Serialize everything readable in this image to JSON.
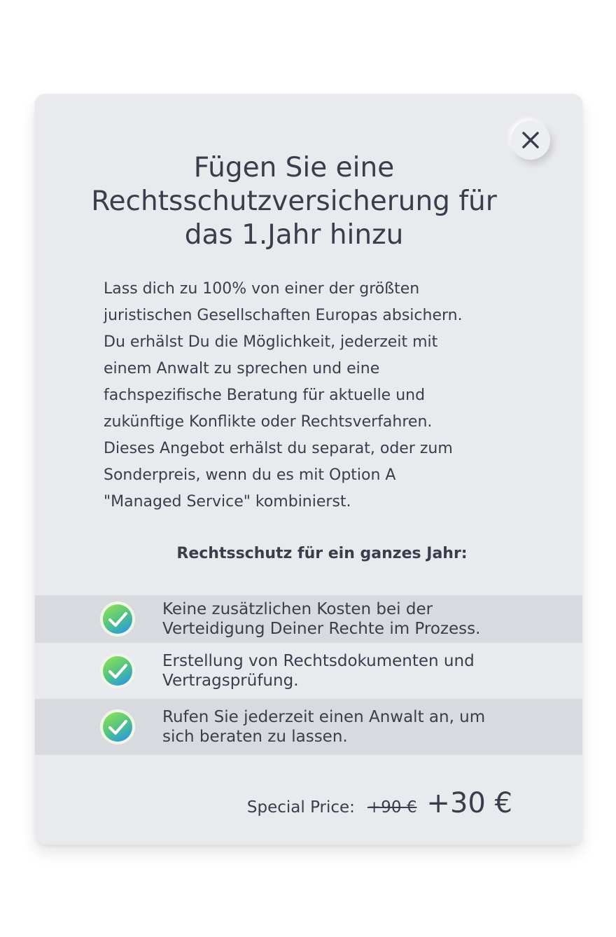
{
  "modal": {
    "title": "Fügen Sie eine Rechtsschutzversicherung für das 1.Jahr hinzu",
    "description": "Lass dich zu 100% von einer der größten\njuristischen Gesellschaften Europas absichern.\nDu erhälst Du die Möglichkeit, jederzeit mit\neinem Anwalt zu sprechen und eine\nfachspezifische Beratung  für aktuelle und\nzukünftige Konflikte oder Rechtsverfahren.\nDieses Angebot erhälst du separat, oder zum\nSonderpreis, wenn du es mit  Option A\n\"Managed Service\" kombinierst.",
    "features_heading": "Rechtsschutz für ein ganzes Jahr:",
    "features": [
      {
        "text": "Keine zusätzlichen Kosten bei der\nVerteidigung Deiner Rechte im Prozess.",
        "icon": "check-circle-icon"
      },
      {
        "text": "Erstellung von Rechtsdokumenten und\nVertragsprüfung.",
        "icon": "check-circle-icon"
      },
      {
        "text": "Rufen Sie jederzeit einen Anwalt an, um\nsich beraten zu lassen.",
        "icon": "check-circle-icon"
      }
    ],
    "price": {
      "label": "Special Price:",
      "old": "+90 €",
      "new": "+30 €"
    },
    "close_icon": "close-icon"
  },
  "colors": {
    "card_background": "#e9eaee",
    "shaded_row": "#d9dadf",
    "text": "#3a3d4c",
    "check_green": "#7fd44a",
    "check_blue": "#3aa7d8"
  }
}
